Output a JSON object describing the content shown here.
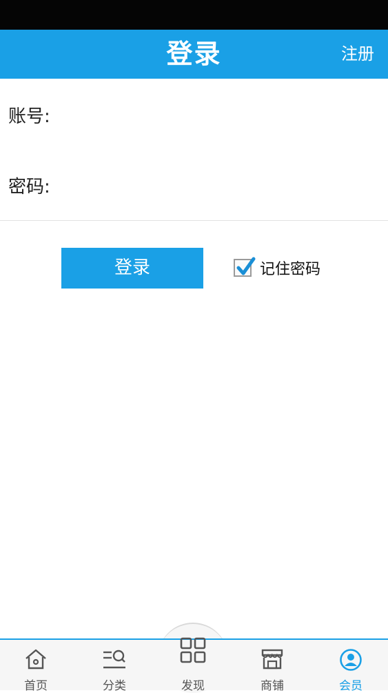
{
  "header": {
    "title": "登录",
    "register_label": "注册"
  },
  "form": {
    "account_label": "账号:",
    "account_value": "",
    "password_label": "密码:",
    "password_value": "",
    "login_button_label": "登录",
    "remember_label": "记住密码",
    "remember_checked": true
  },
  "tabbar": {
    "items": [
      {
        "label": "首页",
        "icon": "home-icon"
      },
      {
        "label": "分类",
        "icon": "category-search-icon"
      },
      {
        "label": "发现",
        "icon": "grid-icon"
      },
      {
        "label": "商铺",
        "icon": "shop-icon"
      },
      {
        "label": "会员",
        "icon": "user-icon",
        "active": true
      }
    ]
  },
  "colors": {
    "accent": "#1aa0e6",
    "status_bar": "#050505",
    "divider": "#e2e2e2"
  }
}
